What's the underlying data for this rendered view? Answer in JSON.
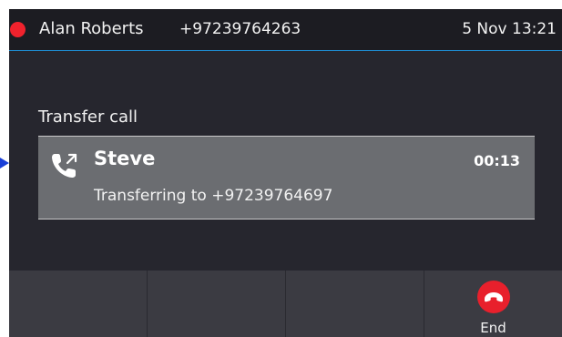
{
  "colors": {
    "status_dot": "#f0222d",
    "accent_line": "#1e8fd6",
    "end_button": "#e8202c",
    "pointer_arrow": "#1a3fd8"
  },
  "status_bar": {
    "contact_name": "Alan Roberts",
    "contact_number": "+97239764263",
    "date_time": "5 Nov 13:21"
  },
  "screen": {
    "title": "Transfer call"
  },
  "call": {
    "icon": "call-transfer-icon",
    "name": "Steve",
    "duration": "00:13",
    "status": "Transferring to +97239764697"
  },
  "softkeys": [
    {
      "label": "",
      "icon": ""
    },
    {
      "label": "",
      "icon": ""
    },
    {
      "label": "",
      "icon": ""
    },
    {
      "label": "End",
      "icon": "end-call-icon"
    }
  ]
}
